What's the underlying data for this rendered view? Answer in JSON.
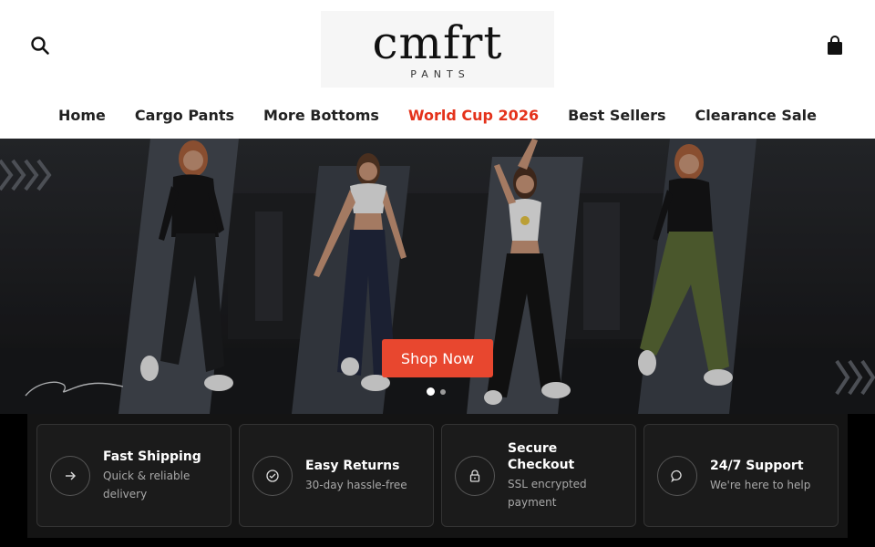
{
  "brand": {
    "logo_main": "cmfrt",
    "logo_sub": "PANTS"
  },
  "header": {
    "search_icon": "search-icon",
    "cart_icon": "shopping-bag-icon"
  },
  "nav": {
    "items": [
      {
        "label": "Home"
      },
      {
        "label": "Cargo Pants"
      },
      {
        "label": "More Bottoms"
      },
      {
        "label": "World Cup 2026",
        "color": "#e4321b"
      },
      {
        "label": "Best Sellers"
      },
      {
        "label": "Clearance Sale"
      }
    ]
  },
  "hero": {
    "cta_label": "Shop Now",
    "cta_color": "#e8472f",
    "slides_total": 2,
    "active_slide": 1
  },
  "features": [
    {
      "title": "Fast Shipping",
      "desc_line1": "Quick & reliable",
      "desc_line2": "delivery",
      "icon": "arrow-right-icon"
    },
    {
      "title": "Easy Returns",
      "desc_line1": "30-day hassle-free",
      "desc_line2": "",
      "icon": "check-circle-icon"
    },
    {
      "title": "Secure Checkout",
      "desc_line1": "SSL encrypted",
      "desc_line2": "payment",
      "icon": "lock-icon"
    },
    {
      "title": "24/7 Support",
      "desc_line1": "We're here to help",
      "desc_line2": "",
      "icon": "chat-bubble-icon"
    }
  ]
}
